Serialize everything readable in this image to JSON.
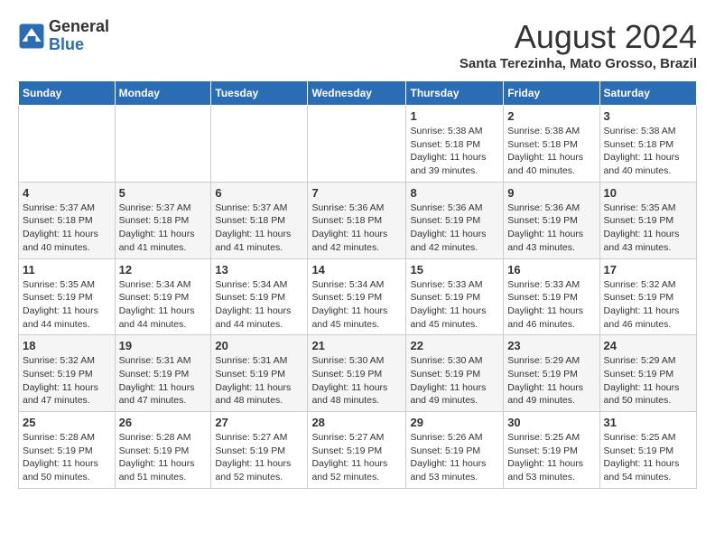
{
  "header": {
    "logo_general": "General",
    "logo_blue": "Blue",
    "title": "August 2024",
    "subtitle": "Santa Terezinha, Mato Grosso, Brazil"
  },
  "days_of_week": [
    "Sunday",
    "Monday",
    "Tuesday",
    "Wednesday",
    "Thursday",
    "Friday",
    "Saturday"
  ],
  "weeks": [
    [
      {
        "num": "",
        "info": ""
      },
      {
        "num": "",
        "info": ""
      },
      {
        "num": "",
        "info": ""
      },
      {
        "num": "",
        "info": ""
      },
      {
        "num": "1",
        "info": "Sunrise: 5:38 AM\nSunset: 5:18 PM\nDaylight: 11 hours and 39 minutes."
      },
      {
        "num": "2",
        "info": "Sunrise: 5:38 AM\nSunset: 5:18 PM\nDaylight: 11 hours and 40 minutes."
      },
      {
        "num": "3",
        "info": "Sunrise: 5:38 AM\nSunset: 5:18 PM\nDaylight: 11 hours and 40 minutes."
      }
    ],
    [
      {
        "num": "4",
        "info": "Sunrise: 5:37 AM\nSunset: 5:18 PM\nDaylight: 11 hours and 40 minutes."
      },
      {
        "num": "5",
        "info": "Sunrise: 5:37 AM\nSunset: 5:18 PM\nDaylight: 11 hours and 41 minutes."
      },
      {
        "num": "6",
        "info": "Sunrise: 5:37 AM\nSunset: 5:18 PM\nDaylight: 11 hours and 41 minutes."
      },
      {
        "num": "7",
        "info": "Sunrise: 5:36 AM\nSunset: 5:18 PM\nDaylight: 11 hours and 42 minutes."
      },
      {
        "num": "8",
        "info": "Sunrise: 5:36 AM\nSunset: 5:19 PM\nDaylight: 11 hours and 42 minutes."
      },
      {
        "num": "9",
        "info": "Sunrise: 5:36 AM\nSunset: 5:19 PM\nDaylight: 11 hours and 43 minutes."
      },
      {
        "num": "10",
        "info": "Sunrise: 5:35 AM\nSunset: 5:19 PM\nDaylight: 11 hours and 43 minutes."
      }
    ],
    [
      {
        "num": "11",
        "info": "Sunrise: 5:35 AM\nSunset: 5:19 PM\nDaylight: 11 hours and 44 minutes."
      },
      {
        "num": "12",
        "info": "Sunrise: 5:34 AM\nSunset: 5:19 PM\nDaylight: 11 hours and 44 minutes."
      },
      {
        "num": "13",
        "info": "Sunrise: 5:34 AM\nSunset: 5:19 PM\nDaylight: 11 hours and 44 minutes."
      },
      {
        "num": "14",
        "info": "Sunrise: 5:34 AM\nSunset: 5:19 PM\nDaylight: 11 hours and 45 minutes."
      },
      {
        "num": "15",
        "info": "Sunrise: 5:33 AM\nSunset: 5:19 PM\nDaylight: 11 hours and 45 minutes."
      },
      {
        "num": "16",
        "info": "Sunrise: 5:33 AM\nSunset: 5:19 PM\nDaylight: 11 hours and 46 minutes."
      },
      {
        "num": "17",
        "info": "Sunrise: 5:32 AM\nSunset: 5:19 PM\nDaylight: 11 hours and 46 minutes."
      }
    ],
    [
      {
        "num": "18",
        "info": "Sunrise: 5:32 AM\nSunset: 5:19 PM\nDaylight: 11 hours and 47 minutes."
      },
      {
        "num": "19",
        "info": "Sunrise: 5:31 AM\nSunset: 5:19 PM\nDaylight: 11 hours and 47 minutes."
      },
      {
        "num": "20",
        "info": "Sunrise: 5:31 AM\nSunset: 5:19 PM\nDaylight: 11 hours and 48 minutes."
      },
      {
        "num": "21",
        "info": "Sunrise: 5:30 AM\nSunset: 5:19 PM\nDaylight: 11 hours and 48 minutes."
      },
      {
        "num": "22",
        "info": "Sunrise: 5:30 AM\nSunset: 5:19 PM\nDaylight: 11 hours and 49 minutes."
      },
      {
        "num": "23",
        "info": "Sunrise: 5:29 AM\nSunset: 5:19 PM\nDaylight: 11 hours and 49 minutes."
      },
      {
        "num": "24",
        "info": "Sunrise: 5:29 AM\nSunset: 5:19 PM\nDaylight: 11 hours and 50 minutes."
      }
    ],
    [
      {
        "num": "25",
        "info": "Sunrise: 5:28 AM\nSunset: 5:19 PM\nDaylight: 11 hours and 50 minutes."
      },
      {
        "num": "26",
        "info": "Sunrise: 5:28 AM\nSunset: 5:19 PM\nDaylight: 11 hours and 51 minutes."
      },
      {
        "num": "27",
        "info": "Sunrise: 5:27 AM\nSunset: 5:19 PM\nDaylight: 11 hours and 52 minutes."
      },
      {
        "num": "28",
        "info": "Sunrise: 5:27 AM\nSunset: 5:19 PM\nDaylight: 11 hours and 52 minutes."
      },
      {
        "num": "29",
        "info": "Sunrise: 5:26 AM\nSunset: 5:19 PM\nDaylight: 11 hours and 53 minutes."
      },
      {
        "num": "30",
        "info": "Sunrise: 5:25 AM\nSunset: 5:19 PM\nDaylight: 11 hours and 53 minutes."
      },
      {
        "num": "31",
        "info": "Sunrise: 5:25 AM\nSunset: 5:19 PM\nDaylight: 11 hours and 54 minutes."
      }
    ]
  ]
}
